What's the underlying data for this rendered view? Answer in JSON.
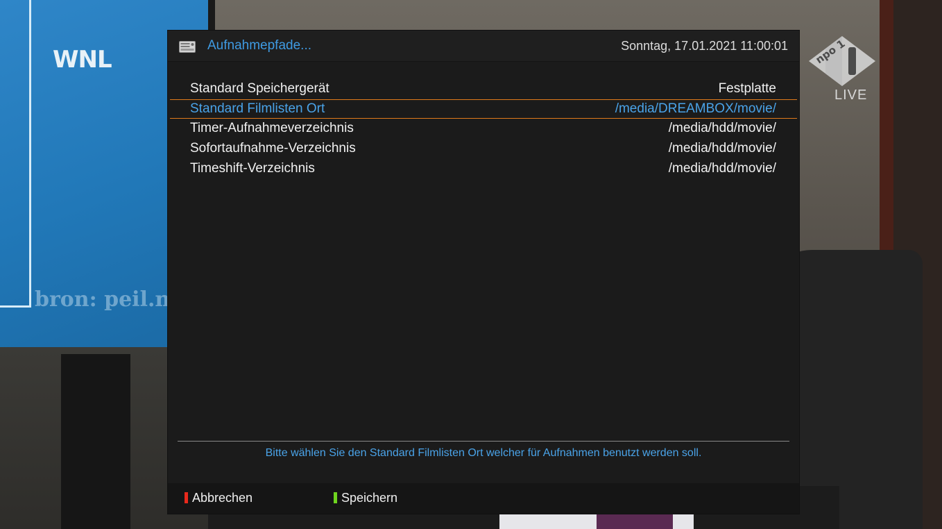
{
  "background": {
    "channel_logo": "WNL",
    "screen_caption": "bron: peil.n",
    "npo_logo": "npo 1",
    "npo_live": "LIVE"
  },
  "dialog": {
    "icon": "harddisk-icon",
    "title": "Aufnahmepfade...",
    "datetime": "Sonntag, 17.01.2021  11:00:01",
    "items": [
      {
        "label": "Standard Speichergerät",
        "value": "Festplatte",
        "selected": false
      },
      {
        "label": "Standard Filmlisten Ort",
        "value": "/media/DREAMBOX/movie/",
        "selected": true
      },
      {
        "label": "Timer-Aufnahmeverzeichnis",
        "value": "/media/hdd/movie/",
        "selected": false
      },
      {
        "label": "Sofortaufnahme-Verzeichnis",
        "value": "/media/hdd/movie/",
        "selected": false
      },
      {
        "label": "Timeshift-Verzeichnis",
        "value": "/media/hdd/movie/",
        "selected": false
      }
    ],
    "help_text": "Bitte wählen Sie den Standard Filmlisten Ort welcher für Aufnahmen benutzt werden soll.",
    "buttons": {
      "red": {
        "label": "Abbrechen",
        "color": "#e8291c"
      },
      "green": {
        "label": "Speichern",
        "color": "#6fd41f"
      }
    }
  },
  "colors": {
    "accent_blue": "#4aa3e8",
    "selection_border": "#e07a1b"
  }
}
